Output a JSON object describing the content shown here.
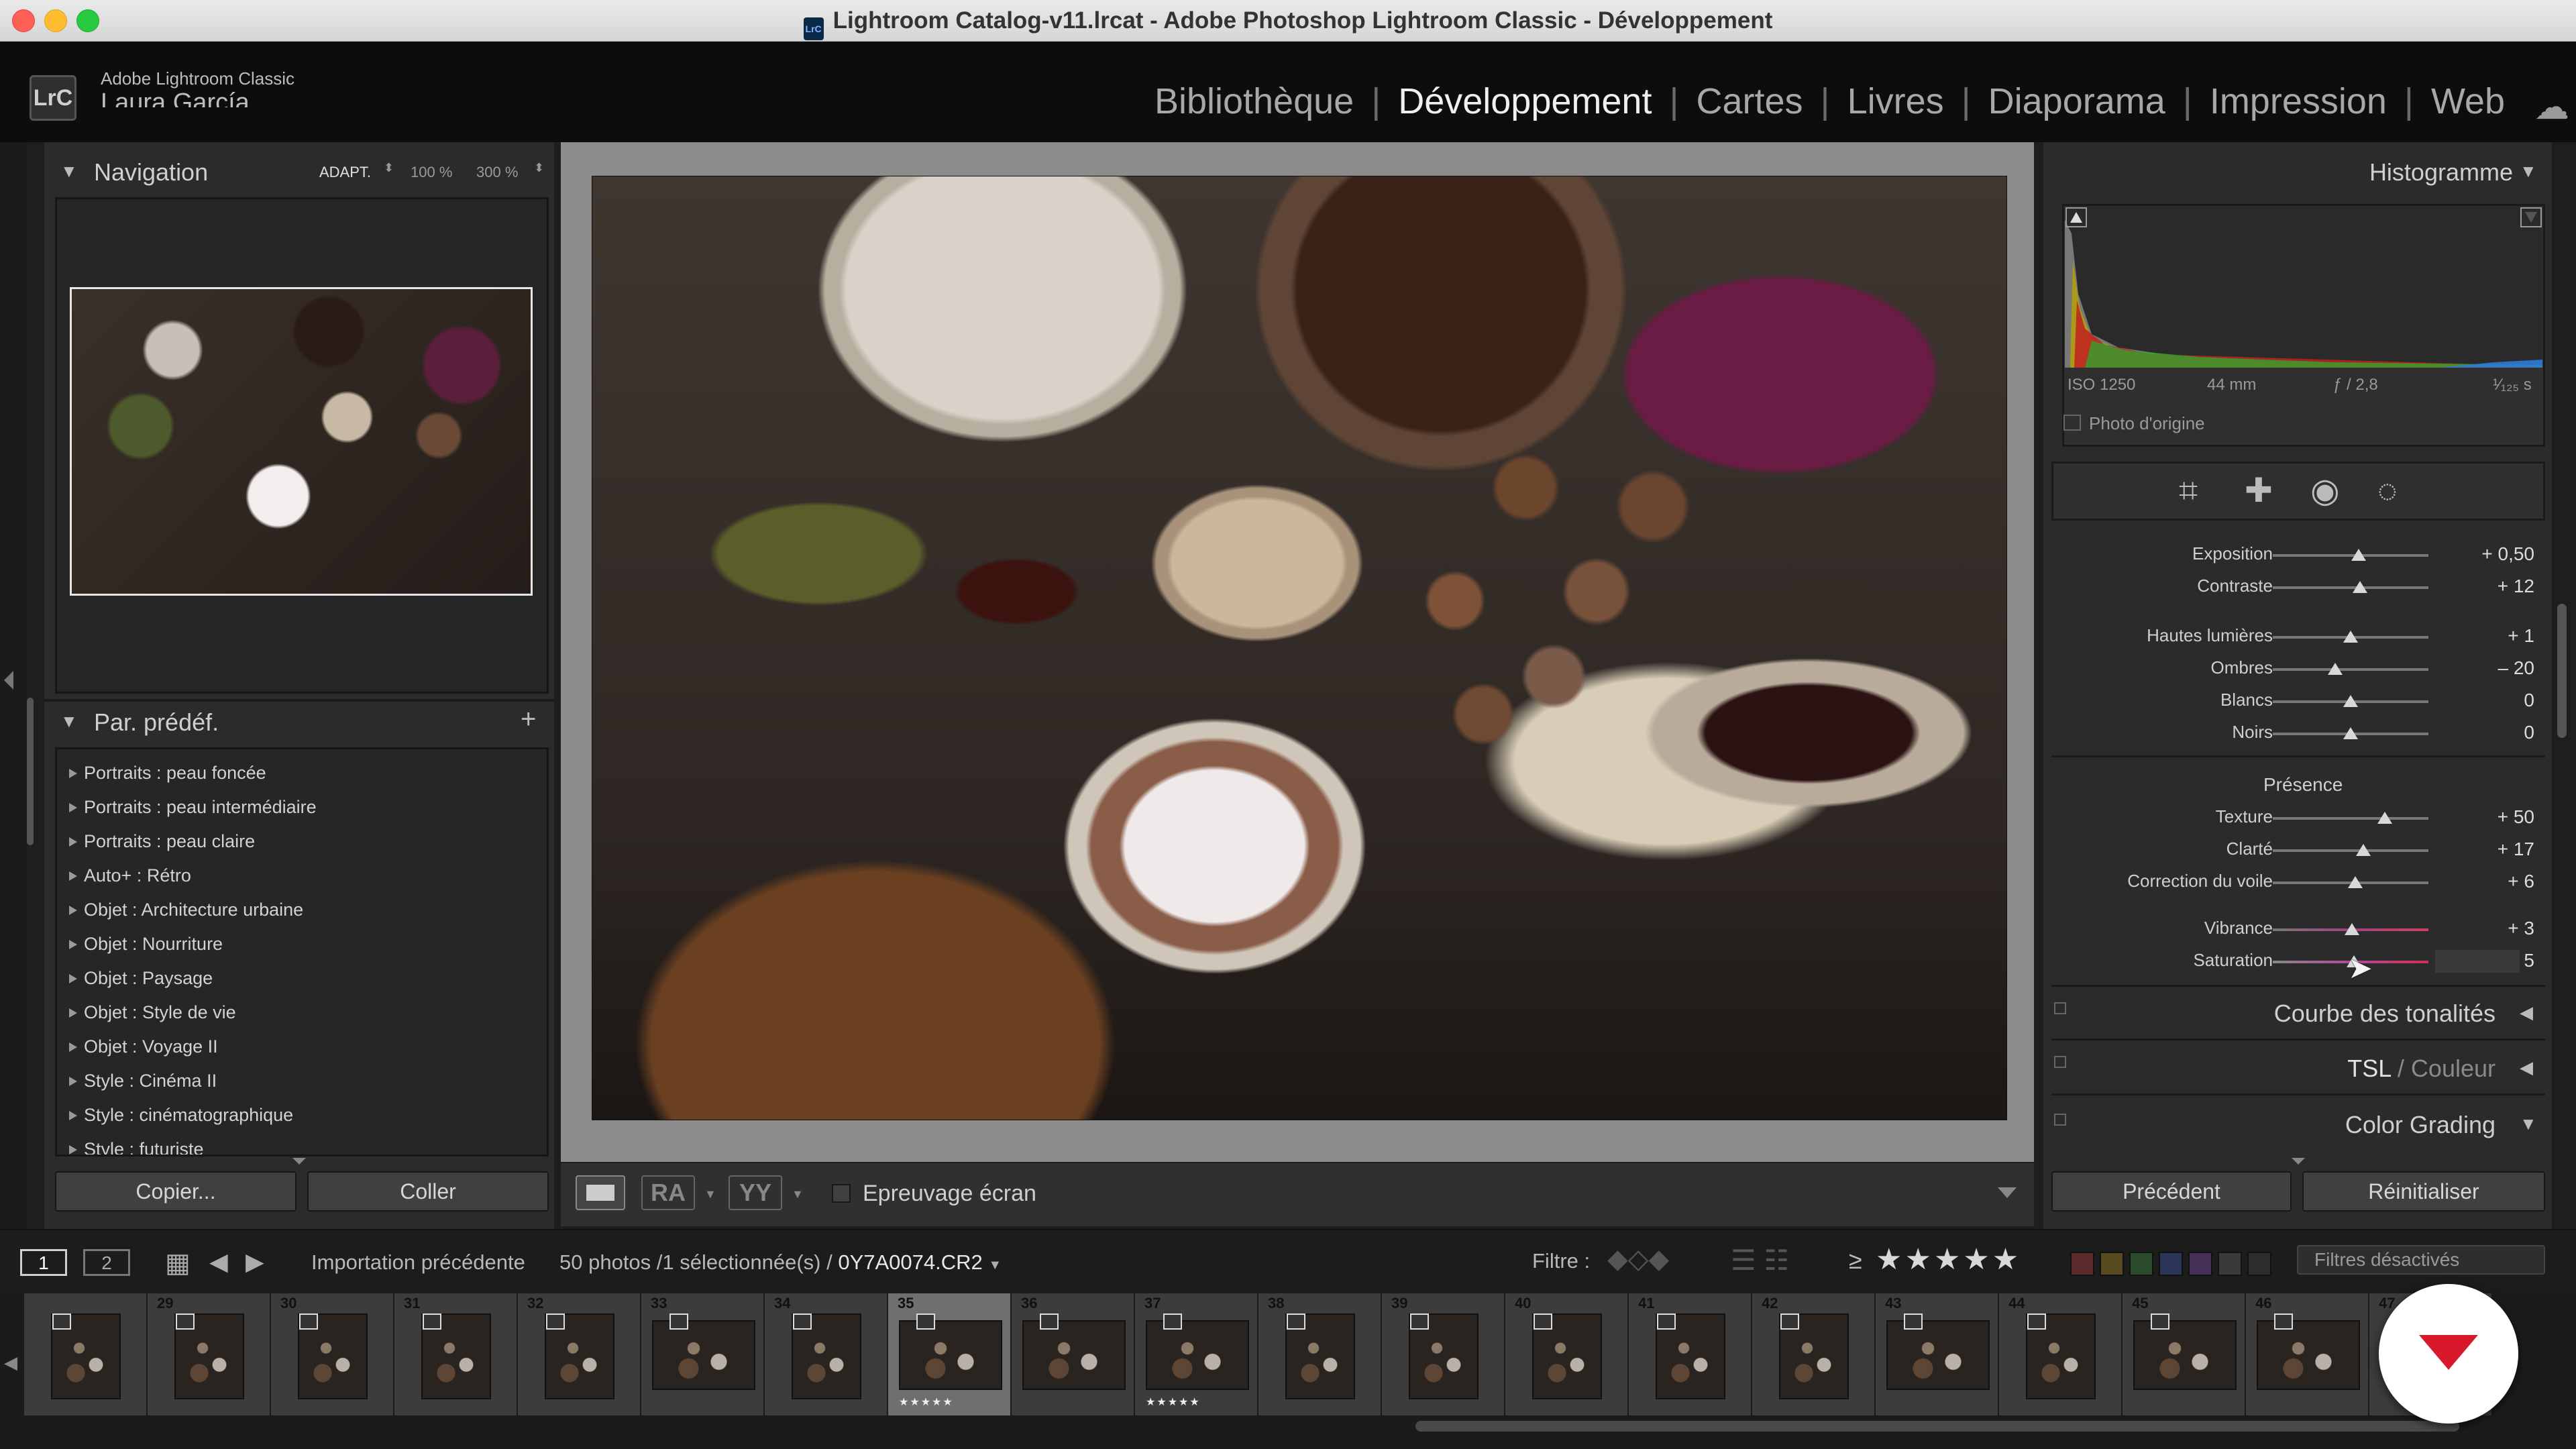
{
  "window": {
    "title": "Lightroom Catalog-v11.lrcat - Adobe Photoshop Lightroom Classic - Développement",
    "doc_icon": "LrC"
  },
  "identity": {
    "logo": "LrC",
    "app_name": "Adobe Lightroom Classic",
    "user": "Laura García"
  },
  "modules": [
    {
      "label": "Bibliothèque",
      "active": false
    },
    {
      "label": "Développement",
      "active": true
    },
    {
      "label": "Cartes",
      "active": false
    },
    {
      "label": "Livres",
      "active": false
    },
    {
      "label": "Diaporama",
      "active": false
    },
    {
      "label": "Impression",
      "active": false
    },
    {
      "label": "Web",
      "active": false
    }
  ],
  "navigator": {
    "title": "Navigation",
    "zoom_fit": "ADAPT.",
    "zoom_100": "100 %",
    "zoom_300": "300 %"
  },
  "presets": {
    "title": "Par. prédéf.",
    "add": "+",
    "items": [
      "Portraits : peau foncée",
      "Portraits : peau intermédiaire",
      "Portraits : peau claire",
      "Auto+ : Rétro",
      "Objet : Architecture urbaine",
      "Objet : Nourriture",
      "Objet : Paysage",
      "Objet : Style de vie",
      "Objet : Voyage II",
      "Style : Cinéma II",
      "Style : cinématographique",
      "Style : futuriste"
    ]
  },
  "left_buttons": {
    "copy": "Copier...",
    "paste": "Coller"
  },
  "toolbar": {
    "soft_proof": "Epreuvage écran"
  },
  "histogram": {
    "title": "Histogramme",
    "iso": "ISO 1250",
    "focal": "44 mm",
    "aperture": "ƒ / 2,8",
    "shutter": "¹⁄₁₂₅ s",
    "original_photo": "Photo d'origine"
  },
  "basic": {
    "tone": [
      {
        "label": "Exposition",
        "value": "+ 0,50",
        "pos": 0.55
      },
      {
        "label": "Contraste",
        "value": "+ 12",
        "pos": 0.56
      }
    ],
    "tone2": [
      {
        "label": "Hautes lumières",
        "value": "+ 1",
        "pos": 0.5
      },
      {
        "label": "Ombres",
        "value": "– 20",
        "pos": 0.4
      },
      {
        "label": "Blancs",
        "value": "0",
        "pos": 0.5
      },
      {
        "label": "Noirs",
        "value": "0",
        "pos": 0.5
      }
    ],
    "presence_title": "Présence",
    "presence": [
      {
        "label": "Texture",
        "value": "+ 50",
        "pos": 0.72
      },
      {
        "label": "Clarté",
        "value": "+ 17",
        "pos": 0.58
      },
      {
        "label": "Correction du voile",
        "value": "+ 6",
        "pos": 0.53
      }
    ],
    "color": [
      {
        "label": "Vibrance",
        "value": "+ 3",
        "pos": 0.51
      },
      {
        "label": "Saturation",
        "value": "+ 5",
        "pos": 0.52
      }
    ]
  },
  "sections": {
    "tone_curve": "Courbe des tonalités",
    "hsl": "TSL",
    "color": "Couleur",
    "color_grading": "Color Grading"
  },
  "right_buttons": {
    "previous": "Précédent",
    "reset": "Réinitialiser"
  },
  "filmstrip_bar": {
    "screen1": "1",
    "screen2": "2",
    "source": "Importation précédente",
    "count": "50 photos /1 sélectionnée(s) /",
    "filename": "0Y7A0074.CR2",
    "filter_label": "Filtre :",
    "rating_op": "≥",
    "stars": "★★★★★",
    "filters_off": "Filtres désactivés"
  },
  "filmstrip": [
    {
      "num": "",
      "stars": ""
    },
    {
      "num": "29",
      "stars": ""
    },
    {
      "num": "30",
      "stars": ""
    },
    {
      "num": "31",
      "stars": ""
    },
    {
      "num": "32",
      "stars": ""
    },
    {
      "num": "33",
      "stars": ""
    },
    {
      "num": "34",
      "stars": ""
    },
    {
      "num": "35",
      "stars": "★★★★★"
    },
    {
      "num": "36",
      "stars": ""
    },
    {
      "num": "37",
      "stars": "★★★★★"
    },
    {
      "num": "38",
      "stars": ""
    },
    {
      "num": "39",
      "stars": ""
    },
    {
      "num": "40",
      "stars": ""
    },
    {
      "num": "41",
      "stars": ""
    },
    {
      "num": "42",
      "stars": ""
    },
    {
      "num": "43",
      "stars": ""
    },
    {
      "num": "44",
      "stars": ""
    },
    {
      "num": "45",
      "stars": ""
    },
    {
      "num": "46",
      "stars": ""
    },
    {
      "num": "47",
      "stars": ""
    }
  ],
  "colors": {
    "accent_red": "#d7192b",
    "panel": "#2b2b2b",
    "background": "#1e1e1e"
  }
}
